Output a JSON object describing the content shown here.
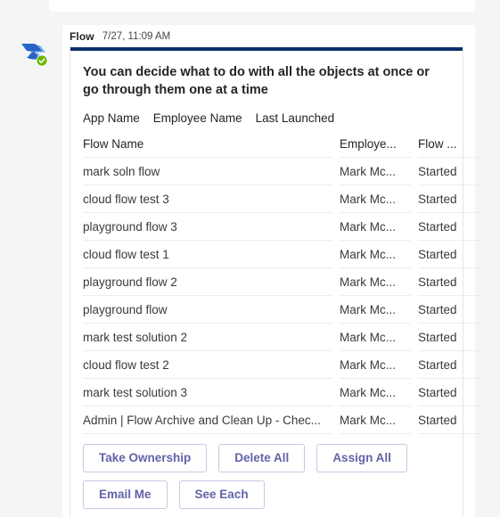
{
  "message": {
    "sender": "Flow",
    "timestamp": "7/27, 11:09 AM",
    "avatar_icon": "power-automate-logo-with-check-badge",
    "accent_color": "#0b2f6b"
  },
  "card": {
    "body_text": "You can decide what to do with all the objects at once or go through them one at a time",
    "column_note": [
      "App Name",
      "Employee Name",
      "Last Launched"
    ],
    "table": {
      "headers": [
        "Flow Name",
        "Employe...",
        "Flow ..."
      ],
      "rows": [
        {
          "flow_name": "mark soln flow",
          "employee": "Mark Mc...",
          "status": "Started"
        },
        {
          "flow_name": "cloud flow test 3",
          "employee": "Mark Mc...",
          "status": "Started"
        },
        {
          "flow_name": "playground flow 3",
          "employee": "Mark Mc...",
          "status": "Started"
        },
        {
          "flow_name": "cloud flow test 1",
          "employee": "Mark Mc...",
          "status": "Started"
        },
        {
          "flow_name": "playground flow 2",
          "employee": "Mark Mc...",
          "status": "Started"
        },
        {
          "flow_name": "playground flow",
          "employee": "Mark Mc...",
          "status": "Started"
        },
        {
          "flow_name": "mark test solution 2",
          "employee": "Mark Mc...",
          "status": "Started"
        },
        {
          "flow_name": "cloud flow test 2",
          "employee": "Mark Mc...",
          "status": "Started"
        },
        {
          "flow_name": "mark test solution 3",
          "employee": "Mark Mc...",
          "status": "Started"
        },
        {
          "flow_name": "Admin | Flow Archive and Clean Up - Chec...",
          "employee": "Mark Mc...",
          "status": "Started"
        }
      ]
    },
    "actions": [
      {
        "label": "Take Ownership",
        "name": "take-ownership-button"
      },
      {
        "label": "Delete All",
        "name": "delete-all-button"
      },
      {
        "label": "Assign All",
        "name": "assign-all-button"
      },
      {
        "label": "Email Me",
        "name": "email-me-button"
      },
      {
        "label": "See Each",
        "name": "see-each-button"
      }
    ],
    "action_color": "#6164a8"
  }
}
